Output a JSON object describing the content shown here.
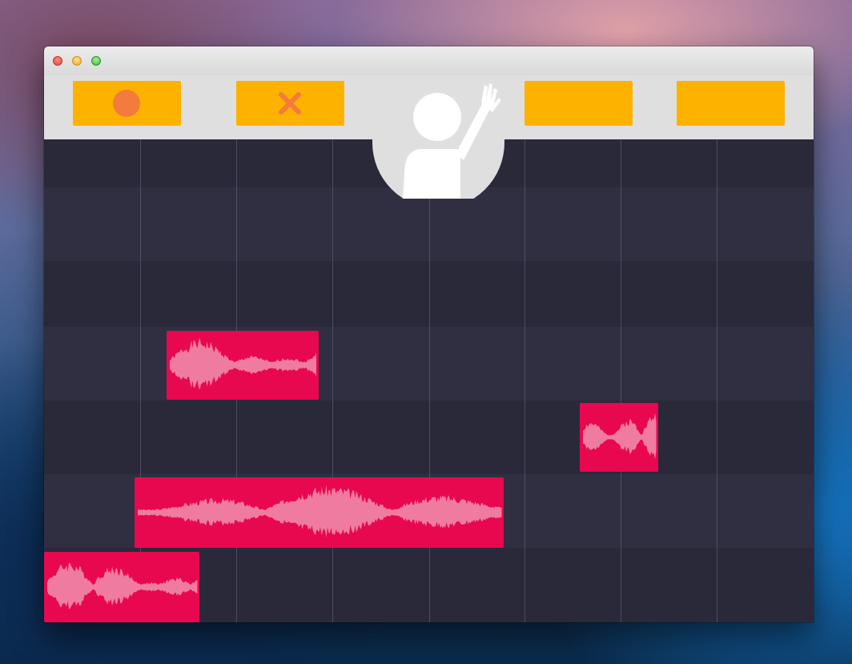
{
  "window": {
    "controls": [
      "close",
      "minimize",
      "zoom"
    ]
  },
  "toolbar": {
    "buttons": [
      {
        "icon": "record-icon"
      },
      {
        "icon": "x-icon"
      },
      {
        "icon": null
      },
      {
        "icon": null
      }
    ],
    "colors": {
      "button": "#fdb200",
      "icon": "#f47b3e",
      "bar": "#dfdfdf"
    }
  },
  "avatar": {
    "icon": "person-waving-icon"
  },
  "tracks": {
    "lane_count": 6,
    "clips": [
      {
        "lane": 2,
        "label": "clip-1"
      },
      {
        "lane": 3,
        "label": "clip-2"
      },
      {
        "lane": 4,
        "label": "clip-3"
      },
      {
        "lane": 5,
        "label": "clip-4"
      }
    ],
    "colors": {
      "clip": "#e8084f",
      "waveform": "#f08aa8",
      "background": "#2d2c3d"
    }
  }
}
